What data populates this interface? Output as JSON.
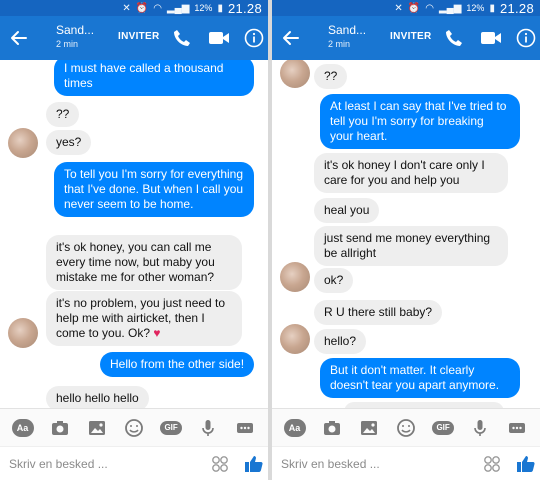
{
  "status_bar": {
    "battery": "12%",
    "time": "21.28"
  },
  "header": {
    "contact_name": "Sand...",
    "last_active": "2 min",
    "invite_label": "INVITER"
  },
  "composer": {
    "placeholder": "Skriv en besked ..."
  },
  "colors": {
    "header_blue": "#1976d2",
    "status_blue": "#1565c0",
    "outgoing_bubble": "#0084ff",
    "incoming_bubble": "#eeeeee",
    "heart": "#e0245e"
  },
  "icons": {
    "header": [
      "back-arrow-icon",
      "phone-icon",
      "video-camera-icon",
      "info-icon"
    ],
    "composer": [
      "text-format-icon",
      "camera-icon",
      "image-icon",
      "emoji-icon",
      "gif-icon",
      "microphone-icon",
      "more-icon",
      "sticker-grid-icon",
      "thumbs-up-icon"
    ]
  },
  "left_thread": [
    {
      "side": "out",
      "text": "I must have called a thousand times"
    },
    {
      "side": "in",
      "text": "??"
    },
    {
      "side": "in",
      "text": "yes?"
    },
    {
      "side": "out",
      "text": "To tell you I'm sorry for everything that I've done. But when I call you never seem to be home."
    },
    {
      "side": "in",
      "text": "it's ok honey, you can call me every time now, but maby you mistake me for other woman?"
    },
    {
      "side": "in",
      "text": "it's no problem, you just need to help me with airticket, then I come to you. Ok?",
      "emoji": "♥"
    },
    {
      "side": "out",
      "text": "Hello from the other side!"
    },
    {
      "side": "in",
      "text": "hello hello hello"
    }
  ],
  "right_thread": [
    {
      "side": "in",
      "text": "??"
    },
    {
      "side": "out",
      "text": "At least I can say that I've tried to tell you I'm sorry for breaking your heart."
    },
    {
      "side": "in",
      "text": "it's ok honey I don't care only I care for you and help you"
    },
    {
      "side": "in",
      "text": "heal you"
    },
    {
      "side": "in",
      "text": "just send me money everything be allright"
    },
    {
      "side": "in",
      "text": "ok?"
    },
    {
      "side": "in",
      "text": "R U there still baby?"
    },
    {
      "side": "in",
      "text": "hello?"
    },
    {
      "side": "out",
      "text": "But it don't matter. It clearly doesn't tear you apart anymore."
    }
  ]
}
